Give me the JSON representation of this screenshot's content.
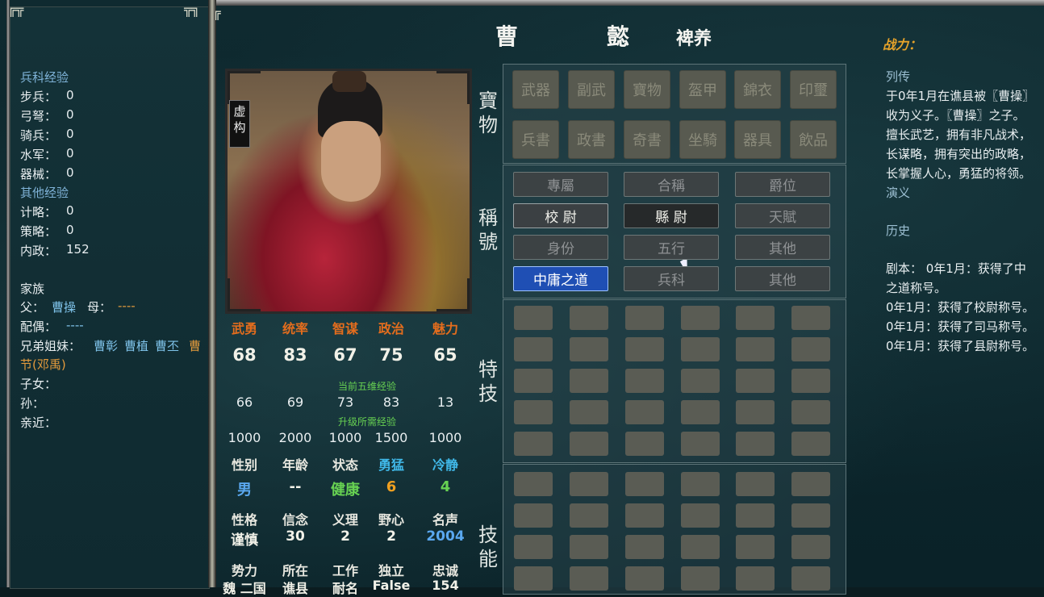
{
  "left_panel": {
    "troop_exp_header": "兵科经验",
    "troop_exp": [
      {
        "label": "步兵：",
        "value": "0"
      },
      {
        "label": "弓弩：",
        "value": "0"
      },
      {
        "label": "骑兵：",
        "value": "0"
      },
      {
        "label": "水军：",
        "value": "0"
      },
      {
        "label": "器械：",
        "value": "0"
      }
    ],
    "other_exp_header": "其他经验",
    "other_exp": [
      {
        "label": "计略：",
        "value": "0"
      },
      {
        "label": "策略：",
        "value": "0"
      },
      {
        "label": "内政：",
        "value": "152"
      }
    ],
    "family_header": "家族",
    "father_label": "父：",
    "father": "曹操",
    "mother_label": "母：",
    "mother": "----",
    "spouse_label": "配偶：",
    "spouse": "----",
    "siblings_label": "兄弟姐妹：",
    "siblings": [
      "曹彰",
      "曹植",
      "曹丕"
    ],
    "sibling_more_line1": "曹",
    "sibling_more_line2": "节(邓禹)",
    "children_label": "子女：",
    "grandchildren_label": "孙：",
    "close_label": "亲近："
  },
  "header": {
    "surname": "曹",
    "given": "懿",
    "style_name": "裨养"
  },
  "portrait": {
    "nameplate": "虚构"
  },
  "stats": {
    "headers": [
      "武勇",
      "统率",
      "智谋",
      "政治",
      "魅力"
    ],
    "values": [
      "68",
      "83",
      "67",
      "75",
      "65"
    ],
    "current_exp_label": "当前五维经验",
    "current_exp": [
      "66",
      "69",
      "73",
      "83",
      "13"
    ],
    "required_exp_label": "升级所需经验",
    "required_exp": [
      "1000",
      "2000",
      "1000",
      "1500",
      "1000"
    ]
  },
  "attrs1": {
    "headers": [
      "性别",
      "年龄",
      "状态",
      "勇猛",
      "冷静"
    ],
    "values": [
      "男",
      "--",
      "健康",
      "6",
      "4"
    ],
    "header_colors": [
      "#e8e8e0",
      "#e8e8e0",
      "#e8e8e0",
      "#40b8e8",
      "#40b8e8"
    ],
    "value_colors": [
      "#5aa8f0",
      "#f1f1e8",
      "#67d152",
      "#f0a020",
      "#67d152"
    ]
  },
  "attrs2": {
    "headers": [
      "性格",
      "信念",
      "义理",
      "野心",
      "名声"
    ],
    "values": [
      "谨慎",
      "30",
      "2",
      "2",
      "2004"
    ],
    "value_colors": [
      "#f1f1e8",
      "#f1f1e8",
      "#f1f1e8",
      "#f1f1e8",
      "#5aa8f0"
    ]
  },
  "attrs3": {
    "headers": [
      "势力",
      "所在",
      "工作",
      "独立",
      "忠诚"
    ],
    "values": [
      "魏 二国",
      "谯县",
      "耐名",
      "False",
      "154"
    ]
  },
  "treasure": {
    "label_top": "寶",
    "label_bottom": "物",
    "row1": [
      "武器",
      "副武",
      "寶物",
      "盔甲",
      "錦衣",
      "印璽"
    ],
    "row2": [
      "兵書",
      "政書",
      "奇書",
      "坐騎",
      "器具",
      "飲品"
    ]
  },
  "titles": {
    "label_top": "稱",
    "label_bottom": "號",
    "buttons": [
      [
        "專屬",
        "合稱",
        "爵位"
      ],
      [
        "校 尉",
        "縣 尉",
        "天賦"
      ],
      [
        "身份",
        "五行",
        "其他"
      ],
      [
        "中庸之道",
        "兵科",
        "其他"
      ]
    ]
  },
  "special": {
    "label_top": "特",
    "label_bottom": "技"
  },
  "skills": {
    "label_top": "技",
    "label_bottom": "能"
  },
  "right_panel": {
    "power_label": "战力：",
    "bio_header": "列传",
    "bio_lines": [
      "于0年1月在谯县被〖曹操〗",
      "收为义子。〖曹操〗之子。",
      "擅长武艺，拥有非凡战术，",
      "长谋略，拥有突出的政略，",
      "长掌握人心，勇猛的将领。"
    ],
    "yanyi": "演义",
    "history_header": "历史",
    "history_lines": [
      "剧本： 0年1月：获得了中",
      "之道称号。",
      "0年1月：获得了校尉称号。",
      "0年1月：获得了司马称号。",
      "0年1月：获得了县尉称号。"
    ]
  }
}
